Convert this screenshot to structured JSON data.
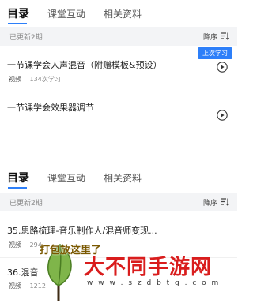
{
  "panel1": {
    "tabs": [
      "目录",
      "课堂互动",
      "相关资料"
    ],
    "update_text": "已更新2期",
    "sort_label": "降序",
    "badge": "上次学习",
    "lessons": [
      {
        "title": "一节课学会人声混音（附赠模板&预设）",
        "kind": "视频",
        "count": "134次学习"
      },
      {
        "title": "一节课学会效果器调节",
        "kind": "",
        "count": ""
      }
    ]
  },
  "panel2": {
    "tabs": [
      "目录",
      "课堂互动",
      "相关资料"
    ],
    "update_text": "已更新2期",
    "sort_label": "降序",
    "lessons": [
      {
        "title": "35.思路梳理-音乐制作人/混音师变现...",
        "kind": "视频",
        "count": "294"
      },
      {
        "title": "36.混音",
        "kind": "视频",
        "count": "1212"
      }
    ]
  },
  "watermark": {
    "bubble": "打包放这里了",
    "brand": "大不同手游网",
    "url": "w w w . s z d b t g . c o m"
  },
  "colors": {
    "accent": "#2d7ff9",
    "brand_red": "#d91d1d"
  }
}
